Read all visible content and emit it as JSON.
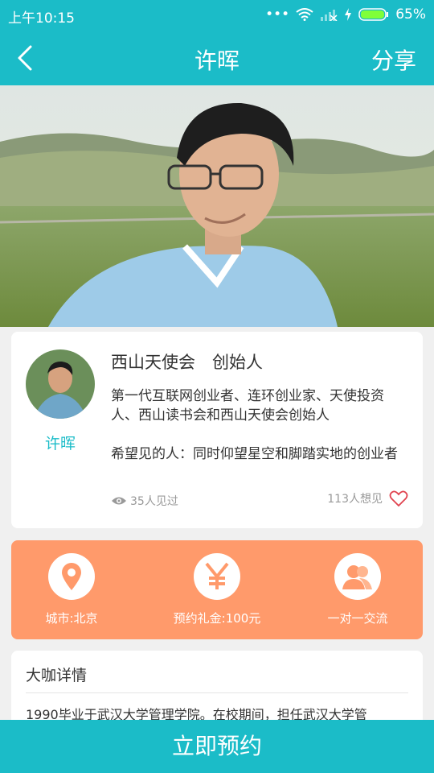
{
  "status": {
    "time": "上午10:15",
    "battery": "65%"
  },
  "nav": {
    "title": "许晖",
    "share": "分享"
  },
  "profile": {
    "headline": "西山天使会　创始人",
    "name": "许晖",
    "bio": "第一代互联网创业者、连环创业家、天使投资人、西山读书会和西山天使会创始人",
    "hope": "希望见的人：同时仰望星空和脚踏实地的创业者",
    "seen": "35人见过",
    "want": "113人想见"
  },
  "features": [
    {
      "icon": "location-pin-icon",
      "label": "城市:北京"
    },
    {
      "icon": "yen-icon",
      "label": "预约礼金:100元"
    },
    {
      "icon": "people-icon",
      "label": "一对一交流"
    }
  ],
  "detail": {
    "title": "大咖详情",
    "text": "1990毕业于武汉大学管理学院。在校期间，担任武汉大学管"
  },
  "cta": {
    "label": "立即预约"
  },
  "colors": {
    "primary": "#1bbcc8",
    "accent": "#ff9a6b"
  }
}
